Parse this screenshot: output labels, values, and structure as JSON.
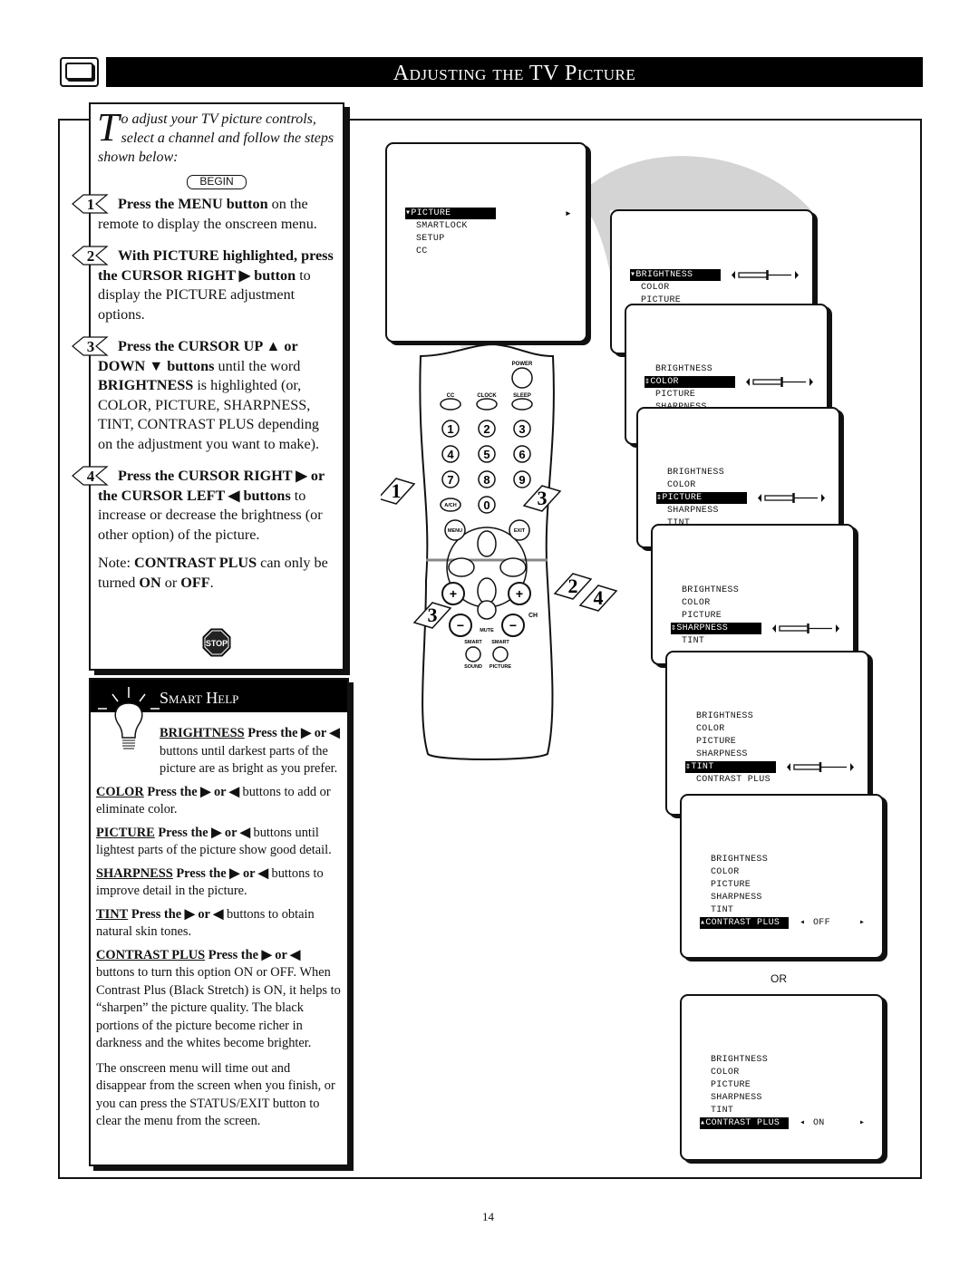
{
  "header": {
    "title": "Adjusting the TV Picture"
  },
  "intro": {
    "dropcap": "T",
    "text": "o adjust your TV picture controls, select a channel and follow the steps shown below:",
    "begin": "BEGIN"
  },
  "steps": [
    {
      "num": "1",
      "parts": [
        {
          "t": "Press the MENU button",
          "b": true
        },
        {
          "t": " on the remote to display the onscreen menu."
        }
      ]
    },
    {
      "num": "2",
      "parts": [
        {
          "t": "With PICTURE highlighted, press the CURSOR RIGHT ▶ button",
          "b": true
        },
        {
          "t": " to display the PICTURE adjustment options."
        }
      ]
    },
    {
      "num": "3",
      "parts": [
        {
          "t": "Press the CURSOR UP ▲ or DOWN ▼ buttons",
          "b": true
        },
        {
          "t": " until the word "
        },
        {
          "t": "BRIGHTNESS",
          "b": true
        },
        {
          "t": " is highlighted (or, COLOR, PICTURE, SHARPNESS, TINT, CONTRAST PLUS depending on the adjustment you want to make)."
        }
      ]
    },
    {
      "num": "4",
      "parts": [
        {
          "t": "Press the CURSOR RIGHT ▶ or the CURSOR LEFT ◀ buttons",
          "b": true
        },
        {
          "t": " to increase or decrease the brightness (or other option) of the picture."
        }
      ]
    }
  ],
  "note": {
    "p0": "Note: ",
    "p1": "CONTRAST PLUS",
    "p2": " can only be turned ",
    "p3": "ON",
    "p4": " or ",
    "p5": "OFF",
    "p6": "."
  },
  "stop_label": "STOP",
  "smart_help": {
    "title": "Smart Help",
    "items": [
      {
        "term": "BRIGHTNESS",
        "press": "Press the ▶ or ◀",
        "text": " buttons until darkest parts of the picture are as bright as you prefer."
      },
      {
        "term": "COLOR",
        "press": "Press the ▶ or ◀",
        "text": " buttons to add or eliminate color."
      },
      {
        "term": "PICTURE",
        "press": "Press the ▶ or ◀",
        "text": " buttons until lightest parts of the picture show good detail."
      },
      {
        "term": "SHARPNESS",
        "press": "Press the ▶ or ◀",
        "text": " buttons to improve detail in the picture."
      },
      {
        "term": "TINT",
        "press": "Press the ▶ or ◀",
        "text": " buttons to obtain natural skin tones."
      },
      {
        "term": "CONTRAST PLUS",
        "press": "Press the ▶ or ◀",
        "text": " buttons to turn this option ON or OFF. When Contrast Plus (Black Stretch) is ON, it helps to “sharpen” the picture quality. The black portions of the picture become richer in darkness and the whites become brighter."
      }
    ],
    "footer": "The onscreen menu will time out and disappear from the screen when you finish, or you can press the STATUS/EXIT button to clear the menu from the screen."
  },
  "remote": {
    "power": "POWER",
    "cc": "CC",
    "clock": "CLOCK",
    "sleep": "SLEEP",
    "digits": [
      "1",
      "2",
      "3",
      "4",
      "5",
      "6",
      "7",
      "8",
      "9"
    ],
    "ach": "A/CH",
    "zero": "0",
    "menu": "MENU",
    "exit": "EXIT",
    "mute": "MUTE",
    "ch": "CH",
    "smart1": "SMART",
    "smart2": "SMART",
    "sound": "SOUND",
    "picture": "PICTURE",
    "callouts": [
      "1",
      "3",
      "2",
      "4",
      "3"
    ]
  },
  "screens": [
    {
      "items": [
        "PICTURE",
        "SMARTLOCK",
        "SETUP",
        "CC"
      ],
      "selected": 0,
      "control": "arrow"
    },
    {
      "items": [
        "BRIGHTNESS",
        "COLOR",
        "PICTURE"
      ],
      "selected": 0,
      "control": "slider",
      "level": 0.55
    },
    {
      "items": [
        "BRIGHTNESS",
        "COLOR",
        "PICTURE",
        "SHARPNESS"
      ],
      "selected": 1,
      "control": "slider",
      "level": 0.55
    },
    {
      "items": [
        "BRIGHTNESS",
        "COLOR",
        "PICTURE",
        "SHARPNESS",
        "TINT"
      ],
      "selected": 2,
      "control": "slider",
      "level": 0.55
    },
    {
      "items": [
        "BRIGHTNESS",
        "COLOR",
        "PICTURE",
        "SHARPNESS",
        "TINT"
      ],
      "selected": 3,
      "control": "slider",
      "level": 0.55
    },
    {
      "items": [
        "BRIGHTNESS",
        "COLOR",
        "PICTURE",
        "SHARPNESS",
        "TINT",
        "CONTRAST PLUS"
      ],
      "selected": 4,
      "control": "slider",
      "level": 0.5
    },
    {
      "items": [
        "BRIGHTNESS",
        "COLOR",
        "PICTURE",
        "SHARPNESS",
        "TINT",
        "CONTRAST PLUS"
      ],
      "selected": 5,
      "control": "value",
      "value": "OFF"
    },
    {
      "items": [
        "BRIGHTNESS",
        "COLOR",
        "PICTURE",
        "SHARPNESS",
        "TINT",
        "CONTRAST PLUS"
      ],
      "selected": 5,
      "control": "value",
      "value": "ON"
    }
  ],
  "or_label": "OR",
  "page_number": "14"
}
